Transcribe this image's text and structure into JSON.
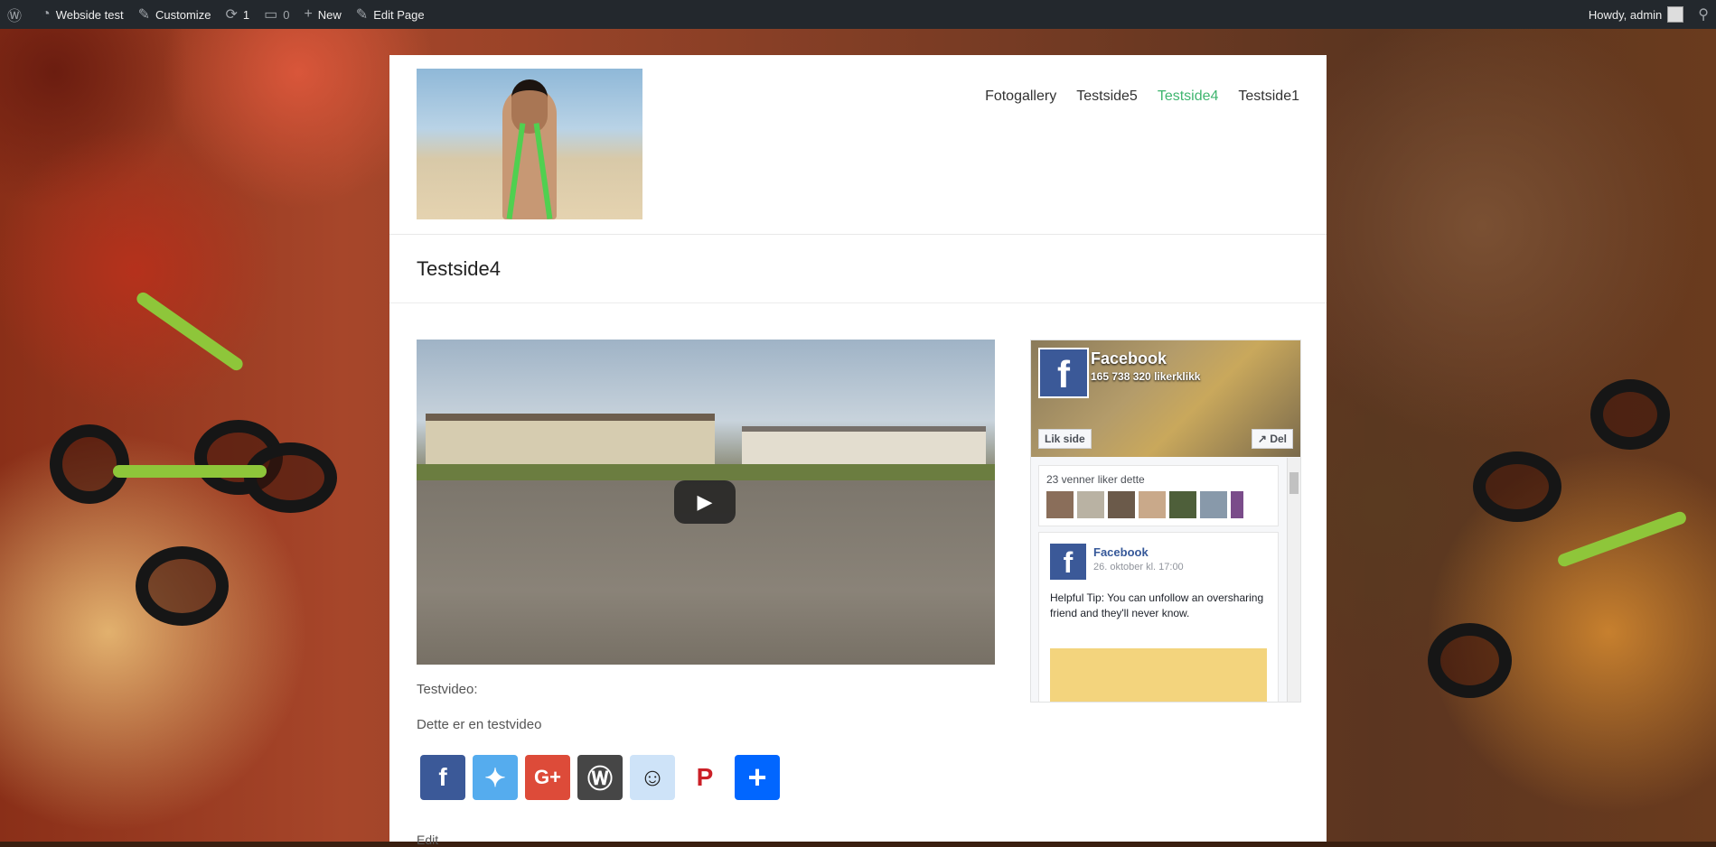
{
  "adminbar": {
    "site_name": "Webside test",
    "customize": "Customize",
    "updates": "1",
    "comments": "0",
    "new": "New",
    "edit_page": "Edit Page",
    "howdy": "Howdy, admin"
  },
  "header": {
    "nav": [
      "Fotogallery",
      "Testside5",
      "Testside4",
      "Testside1"
    ],
    "active_index": 2
  },
  "page": {
    "title": "Testside4",
    "caption1": "Testvideo:",
    "caption2": "Dette er en testvideo",
    "edit": "Edit"
  },
  "share": {
    "buttons": [
      {
        "name": "facebook",
        "glyph": "f",
        "color": "#3b5998"
      },
      {
        "name": "twitter",
        "glyph": "t",
        "color": "#55acee"
      },
      {
        "name": "google-plus",
        "glyph": "G+",
        "color": "#dd4b39"
      },
      {
        "name": "wordpress",
        "glyph": "W",
        "color": "#464646"
      },
      {
        "name": "reddit",
        "glyph": "r",
        "color": "#cee3f8"
      },
      {
        "name": "pinterest",
        "glyph": "P",
        "color": "#ffffff"
      },
      {
        "name": "more",
        "glyph": "+",
        "color": "#0166ff"
      }
    ]
  },
  "facebook": {
    "page_name": "Facebook",
    "likes": "165 738 320 likerklikk",
    "like_button": "Lik side",
    "share_button": "Del",
    "friends_text": "23 venner liker dette",
    "post_name": "Facebook",
    "post_date": "26. oktober kl. 17:00",
    "post_text": "Helpful Tip: You can unfollow an oversharing friend and they'll never know."
  }
}
